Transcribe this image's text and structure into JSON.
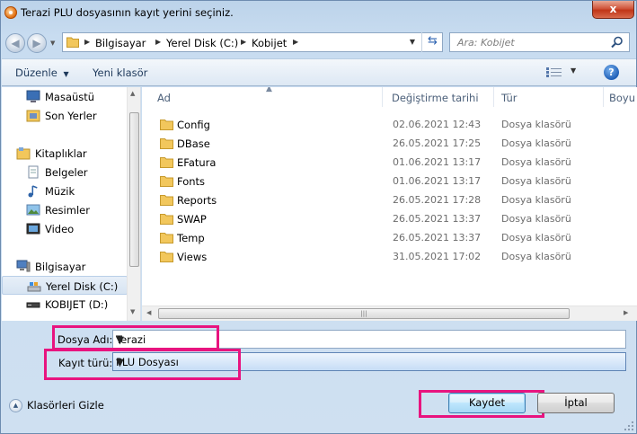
{
  "window": {
    "title": "Terazi PLU dosyasının kayıt yerini seçiniz.",
    "close_label": "x"
  },
  "address": {
    "crumbs": [
      "Bilgisayar",
      "Yerel Disk (C:)",
      "Kobijet"
    ],
    "search_placeholder": "Ara: Kobijet"
  },
  "toolbar": {
    "organize_label": "Düzenle",
    "new_folder_label": "Yeni klasör"
  },
  "sidebar": {
    "items": [
      {
        "label": "Masaüstü",
        "icon": "desktop-icon"
      },
      {
        "label": "Son Yerler",
        "icon": "recent-places-icon"
      },
      {
        "label": "Kitaplıklar",
        "icon": "libraries-icon"
      },
      {
        "label": "Belgeler",
        "icon": "documents-icon"
      },
      {
        "label": "Müzik",
        "icon": "music-icon"
      },
      {
        "label": "Resimler",
        "icon": "pictures-icon"
      },
      {
        "label": "Video",
        "icon": "video-icon"
      },
      {
        "label": "Bilgisayar",
        "icon": "computer-icon"
      },
      {
        "label": "Yerel Disk (C:)",
        "icon": "local-disk-icon"
      },
      {
        "label": "KOBIJET (D:)",
        "icon": "drive-icon"
      }
    ]
  },
  "files": {
    "columns": [
      "Ad",
      "Değiştirme tarihi",
      "Tür",
      "Boyu"
    ],
    "rows": [
      {
        "name": "Config",
        "date": "02.06.2021 12:43",
        "type": "Dosya klasörü"
      },
      {
        "name": "DBase",
        "date": "26.05.2021 17:25",
        "type": "Dosya klasörü"
      },
      {
        "name": "EFatura",
        "date": "01.06.2021 13:17",
        "type": "Dosya klasörü"
      },
      {
        "name": "Fonts",
        "date": "01.06.2021 13:17",
        "type": "Dosya klasörü"
      },
      {
        "name": "Reports",
        "date": "26.05.2021 17:28",
        "type": "Dosya klasörü"
      },
      {
        "name": "SWAP",
        "date": "26.05.2021 13:37",
        "type": "Dosya klasörü"
      },
      {
        "name": "Temp",
        "date": "26.05.2021 13:37",
        "type": "Dosya klasörü"
      },
      {
        "name": "Views",
        "date": "31.05.2021 17:02",
        "type": "Dosya klasörü"
      }
    ]
  },
  "form": {
    "filename_label": "Dosya Adı:",
    "filename_value": "Terazi",
    "type_label": "Kayıt türü:",
    "type_value": "PLU Dosyası"
  },
  "footer": {
    "hide_folders_label": "Klasörleri Gizle",
    "save_label": "Kaydet",
    "cancel_label": "İptal"
  },
  "colors": {
    "highlight": "#e8147f",
    "folder": "#f2c75c"
  }
}
